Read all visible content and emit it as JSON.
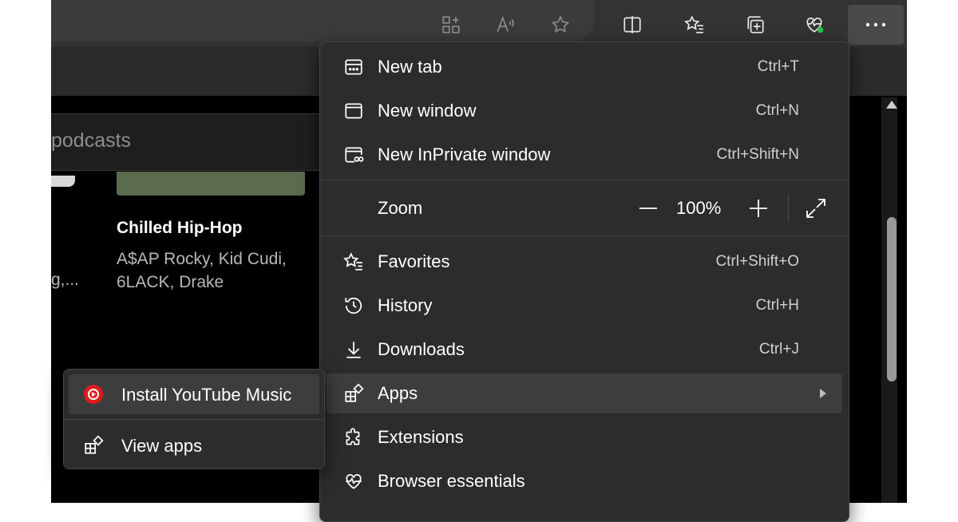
{
  "page": {
    "search_placeholder": "podcasts",
    "card": {
      "title": "Chilled Hip-Hop",
      "artists_line1": "A$AP Rocky, Kid Cudi,",
      "artists_line2": "6LACK, Drake"
    },
    "left_card_sub": "g,..."
  },
  "menu": {
    "new_tab": {
      "label": "New tab",
      "shortcut": "Ctrl+T",
      "icon": "new-tab-icon"
    },
    "new_window": {
      "label": "New window",
      "shortcut": "Ctrl+N",
      "icon": "window-icon"
    },
    "new_inprivate": {
      "label": "New InPrivate window",
      "shortcut": "Ctrl+Shift+N",
      "icon": "inprivate-icon"
    },
    "zoom": {
      "label": "Zoom",
      "value": "100%"
    },
    "favorites": {
      "label": "Favorites",
      "shortcut": "Ctrl+Shift+O",
      "icon": "favorites-star-icon"
    },
    "history": {
      "label": "History",
      "shortcut": "Ctrl+H",
      "icon": "history-icon"
    },
    "downloads": {
      "label": "Downloads",
      "shortcut": "Ctrl+J",
      "icon": "download-icon"
    },
    "apps": {
      "label": "Apps",
      "icon": "apps-icon"
    },
    "extensions": {
      "label": "Extensions",
      "icon": "puzzle-icon"
    },
    "browser_essentials": {
      "label": "Browser essentials",
      "icon": "heartbeat-icon"
    }
  },
  "submenu": {
    "install": {
      "label": "Install YouTube Music",
      "icon": "youtube-music-icon"
    },
    "view_apps": {
      "label": "View apps",
      "icon": "apps-icon"
    }
  },
  "colors": {
    "menu_bg": "#2c2c2c",
    "highlight": "#3d3d3d",
    "youtube_red": "#e01b1b",
    "status_green": "#27c24c"
  }
}
